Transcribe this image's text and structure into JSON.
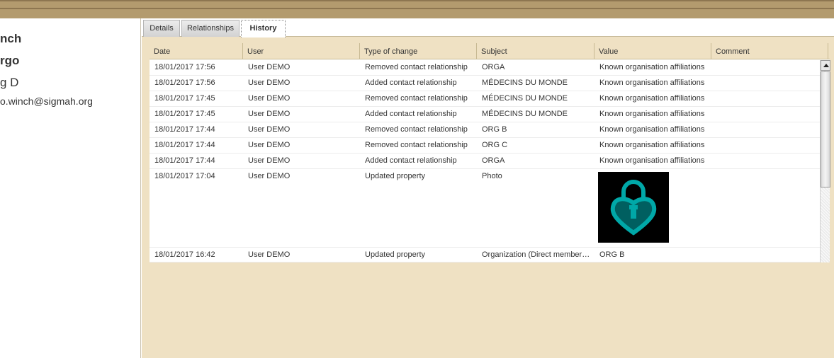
{
  "contact": {
    "name_partial": "nch",
    "org_partial": "rgo",
    "line3_partial": "g D",
    "email_partial": "o.winch@sigmah.org"
  },
  "tabs": [
    {
      "label": "Details",
      "active": false
    },
    {
      "label": "Relationships",
      "active": false
    },
    {
      "label": "History",
      "active": true
    }
  ],
  "grid": {
    "columns": [
      "Date",
      "User",
      "Type of change",
      "Subject",
      "Value",
      "Comment"
    ],
    "rows": [
      {
        "date": "18/01/2017 17:56",
        "user": "User DEMO",
        "type": "Removed contact relationship",
        "subject": "ORGA",
        "value": "Known organisation affiliations",
        "comment": ""
      },
      {
        "date": "18/01/2017 17:56",
        "user": "User DEMO",
        "type": "Added contact relationship",
        "subject": "MÉDECINS DU MONDE",
        "value": "Known organisation affiliations",
        "comment": ""
      },
      {
        "date": "18/01/2017 17:45",
        "user": "User DEMO",
        "type": "Removed contact relationship",
        "subject": "MÉDECINS DU MONDE",
        "value": "Known organisation affiliations",
        "comment": ""
      },
      {
        "date": "18/01/2017 17:45",
        "user": "User DEMO",
        "type": "Added contact relationship",
        "subject": "MÉDECINS DU MONDE",
        "value": "Known organisation affiliations",
        "comment": ""
      },
      {
        "date": "18/01/2017 17:44",
        "user": "User DEMO",
        "type": "Removed contact relationship",
        "subject": "ORG B",
        "value": "Known organisation affiliations",
        "comment": ""
      },
      {
        "date": "18/01/2017 17:44",
        "user": "User DEMO",
        "type": "Removed contact relationship",
        "subject": "ORG C",
        "value": "Known organisation affiliations",
        "comment": ""
      },
      {
        "date": "18/01/2017 17:44",
        "user": "User DEMO",
        "type": "Added contact relationship",
        "subject": "ORGA",
        "value": "Known organisation affiliations",
        "comment": ""
      },
      {
        "date": "18/01/2017 17:04",
        "user": "User DEMO",
        "type": "Updated property",
        "subject": "Photo",
        "value": "",
        "value_image": "lock-photo",
        "comment": ""
      },
      {
        "date": "18/01/2017 16:42",
        "user": "User DEMO",
        "type": "Updated property",
        "subject": "Organization (Direct members…",
        "value": "ORG B",
        "comment": ""
      }
    ]
  },
  "colors": {
    "panel_bg": "#efe1c3",
    "topbar": "#b39b6e",
    "photo_accent": "#00a8a8"
  }
}
